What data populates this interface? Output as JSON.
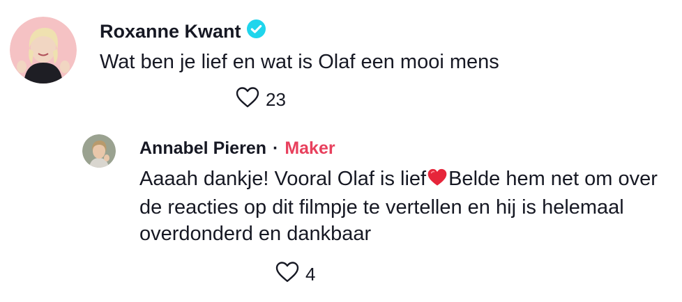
{
  "comments": [
    {
      "author": "Roxanne Kwant",
      "verified": true,
      "text": "Wat ben je lief en wat is Olaf een mooi mens",
      "likes": "23",
      "avatar_icon": "avatar-photo-blonde-woman"
    }
  ],
  "reply": {
    "author": "Annabel Pieren",
    "separator": "·",
    "badge": "Maker",
    "text_before_emoji": "Aaaah dankje! Vooral Olaf is lief",
    "emoji": "red-heart-emoji",
    "text_after_emoji": "Belde hem net om over de reacties op dit filmpje te vertellen en hij is helemaal overdonderd en dankbaar",
    "likes": "4",
    "avatar_icon": "avatar-photo-woman"
  },
  "colors": {
    "text": "#161823",
    "maker": "#e8405d",
    "verified": "#20d5ec",
    "heart_emoji": "#e6253a",
    "like_icon_stroke": "#161823"
  }
}
